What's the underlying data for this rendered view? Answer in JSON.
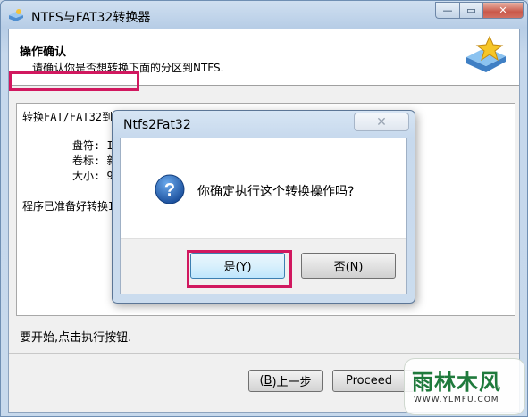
{
  "window": {
    "title": "NTFS与FAT32转换器",
    "min_icon": "—",
    "max_icon": "▭",
    "close_icon": "✕"
  },
  "header": {
    "title": "操作确认",
    "subtitle": "请确认你是否想转换下面的分区到NTFS."
  },
  "log": {
    "line1": "转换FAT/FAT32到NTFS",
    "drive_label": "盘符: I",
    "volume_label": "卷标: 新",
    "size_label": "大小: 9",
    "ready_text": "程序已准备好转换I"
  },
  "status_text": "要开始,点击执行按钮.",
  "buttons": {
    "back_key": "B",
    "back_prefix": "(",
    "back_suffix": ")上一步",
    "proceed": "Proceed"
  },
  "dialog": {
    "title": "Ntfs2Fat32",
    "close_icon": "✕",
    "message": "你确定执行这个转换操作吗?",
    "yes_label": "是(Y)",
    "no_label": "否(N)"
  },
  "watermark": {
    "name": "雨林木风",
    "url": "WWW.YLMFU.COM"
  },
  "colors": {
    "highlight": "#d1185f",
    "title_bar": "#b7cde6",
    "accent": "#3c7fb1"
  }
}
